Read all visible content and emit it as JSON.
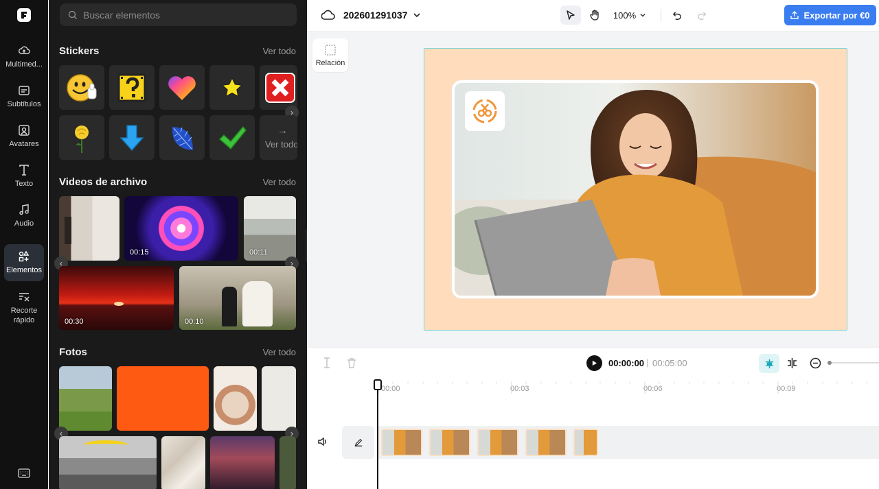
{
  "rail": {
    "items": [
      {
        "label": "Multimed..."
      },
      {
        "label": "Subtítulos"
      },
      {
        "label": "Avatares"
      },
      {
        "label": "Texto"
      },
      {
        "label": "Audio"
      },
      {
        "label": "Elementos"
      },
      {
        "label": "Recorte rápido"
      }
    ],
    "active": "Elementos"
  },
  "panel": {
    "search_placeholder": "Buscar elementos",
    "stickers": {
      "title": "Stickers",
      "see_all": "Ver todo",
      "more_tile": "Ver todo"
    },
    "videos": {
      "title": "Videos de archivo",
      "see_all": "Ver todo",
      "durations": [
        "00:15",
        "00:11",
        "00:30",
        "00:10"
      ]
    },
    "photos": {
      "title": "Fotos",
      "see_all": "Ver todo"
    }
  },
  "topbar": {
    "project_name": "202601291037",
    "zoom": "100%",
    "export_label": "Exportar por €0"
  },
  "stage": {
    "ratio_label": "Relación"
  },
  "timeline": {
    "current_time": "00:00:00",
    "separator": "|",
    "total_time": "00:05:00",
    "ruler_labels": [
      "00:00",
      "00:03",
      "00:06",
      "00:09"
    ]
  },
  "colors": {
    "accent": "#3a7df0",
    "canvas_bg": "#ffdcbb",
    "selection": "#7fd5d8",
    "panel_bg": "#1a1a1a",
    "rail_bg": "#111111"
  }
}
